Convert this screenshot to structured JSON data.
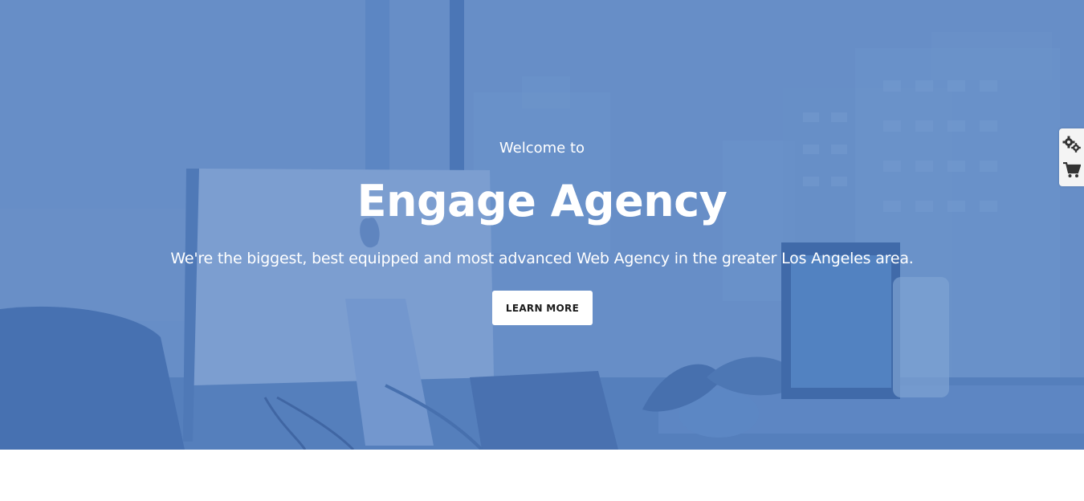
{
  "hero": {
    "welcome": "Welcome to",
    "title": "Engage Agency",
    "subtitle": "We're the biggest, best equipped and most advanced Web Agency in the greater Los Angeles area.",
    "cta_label": "LEARN MORE"
  },
  "side_panel": {
    "items": [
      {
        "icon": "gears-icon"
      },
      {
        "icon": "shopping-cart-icon"
      }
    ]
  },
  "colors": {
    "hero_tint": "#6189c4",
    "button_bg": "#ffffff",
    "button_text": "#1a1a1a",
    "page_bg": "#ffffff"
  }
}
